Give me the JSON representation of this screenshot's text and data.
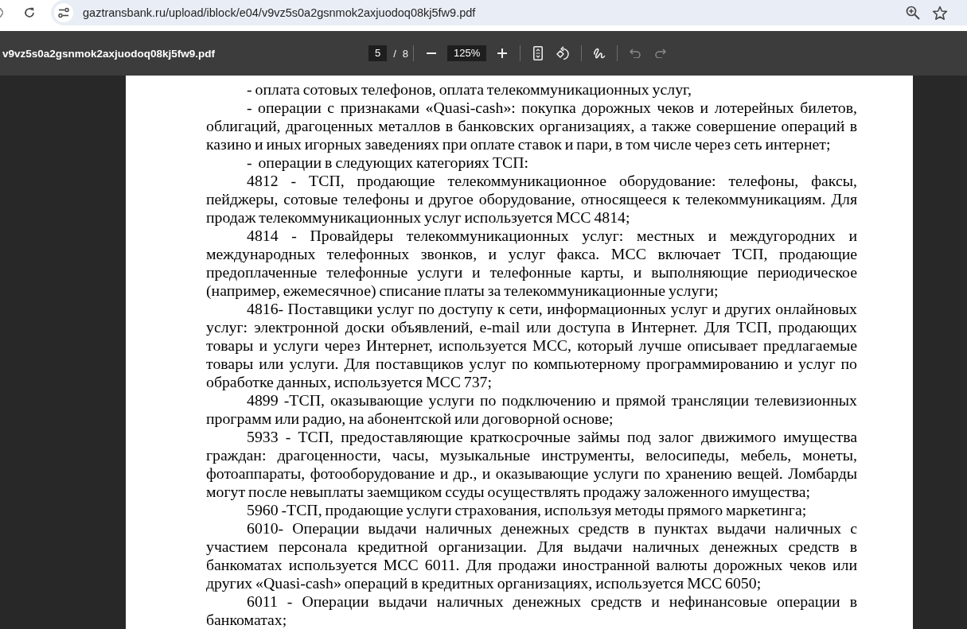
{
  "browser": {
    "url": "gaztransbank.ru/upload/iblock/e04/v9vz5s0a2gsnmok2axjuodoq08kj5fw9.pdf"
  },
  "pdf_toolbar": {
    "title": "v9vz5s0a2gsnmok2axjuodoq08kj5fw9.pdf",
    "page": "5",
    "page_separator": "/",
    "page_count": "8",
    "zoom": "125%",
    "undo": {
      "disabled": true
    },
    "redo": {
      "disabled": true
    }
  },
  "document": {
    "paragraphs": [
      "- оплата сотовых телефонов, оплата телекоммуникационных услуг,",
      "- операции с признаками «Quasi-cash»: покупка дорожных чеков и лотерейных билетов, облигаций, драгоценных металлов в банковских организациях, а также совершение операций в казино и иных игорных заведениях при оплате ставок и пари, в том числе через сеть интернет;",
      "-  операции в следующих категориях ТСП:",
      "4812 - ТСП, продающие телекоммуникационное оборудование: телефоны, факсы, пейджеры, сотовые телефоны и другое оборудование, относящееся к телекоммуникациям. Для продаж телекоммуникационных услуг используется МСС 4814;",
      "4814 - Провайдеры телекоммуникационных услуг: местных и междугородних и международных телефонных звонков, и услуг факса. МСС включает ТСП, продающие предоплаченные телефонные услуги и телефонные карты, и выполняющие периодическое (например, ежемесячное) списание платы за телекоммуникационные услуги;",
      "4816- Поставщики услуг по доступу к сети, информационных услуг и других онлайновых услуг: электронной доски объявлений, e-mail или доступа в Интернет. Для ТСП, продающих товары и услуги через Интернет, используется МСС, который лучше описывает предлагаемые товары или услуги. Для поставщиков услуг по компьютерному программированию и услуг по обработке данных, используется МСС 737;",
      "4899 -ТСП, оказывающие услуги по подключению и прямой трансляции телевизионных программ или радио, на абонентской или договорной основе;",
      "5933 - ТСП, предоставляющие краткосрочные займы под залог движимого имущества граждан: драгоценности, часы, музыкальные инструменты, велосипеды, мебель, монеты, фотоаппараты, фотооборудование и др., и оказывающие услуги по хранению вещей. Ломбарды могут после невыплаты заемщиком ссуды осуществлять продажу заложенного имущества;",
      "5960 -ТСП, продающие услуги страхования, используя методы прямого маркетинга;",
      "6010- Операции выдачи наличных денежных средств в пунктах выдачи наличных с участием персонала кредитной организации. Для выдачи наличных денежных средств в банкоматах используется МСС 6011. Для продажи иностранной валюты дорожных чеков или других «Quasi-cash» операций в кредитных организациях, используется МСС 6050;",
      "6011 - Операции выдачи наличных денежных средств и нефинансовые операции в банкоматах;"
    ]
  }
}
